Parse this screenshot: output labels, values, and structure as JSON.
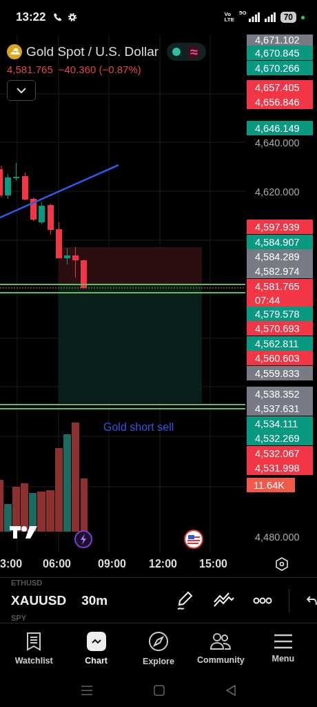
{
  "status_bar": {
    "time": "13:22",
    "volte_top": "Vo",
    "volte_bottom": "LTE",
    "network": "5G",
    "battery": "70"
  },
  "header": {
    "symbol_name": "Gold Spot / U.S. Dollar",
    "market_open_glyph": "≈",
    "price": "4,581.765",
    "change": "−40.360 (−0.87%)"
  },
  "chart": {
    "annotation": "Gold short sell",
    "price_scale": [
      {
        "text": "4,671.102",
        "kind": "tag",
        "color": "#787b86"
      },
      {
        "text": "4,670.845",
        "kind": "tag",
        "color": "#089981"
      },
      {
        "text": "4,670.266",
        "kind": "tag",
        "color": "#089981"
      },
      {
        "text": "4,657.405",
        "kind": "tag",
        "color": "#f23645"
      },
      {
        "text": "4,656.846",
        "kind": "tag",
        "color": "#f23645"
      },
      {
        "text": "4,646.149",
        "kind": "tag",
        "color": "#089981"
      },
      {
        "text": "4,640.000",
        "kind": "tick"
      },
      {
        "text": "4,620.000",
        "kind": "tick"
      },
      {
        "text": "4,597.939",
        "kind": "tag",
        "color": "#f23645"
      },
      {
        "text": "4,584.907",
        "kind": "tag",
        "color": "#089981"
      },
      {
        "text": "4,584.289",
        "kind": "tag",
        "color": "#787b86"
      },
      {
        "text": "4,582.974",
        "kind": "tag",
        "color": "#787b86"
      },
      {
        "text": "4,581.765",
        "kind": "tag",
        "color": "#f23645",
        "countdown": "07:44"
      },
      {
        "text": "4,579.578",
        "kind": "tag",
        "color": "#089981"
      },
      {
        "text": "4,570.693",
        "kind": "tag",
        "color": "#f23645"
      },
      {
        "text": "4,562.811",
        "kind": "tag",
        "color": "#089981"
      },
      {
        "text": "4,560.603",
        "kind": "tag",
        "color": "#f23645"
      },
      {
        "text": "4,559.833",
        "kind": "tag",
        "color": "#787b86"
      },
      {
        "text": "4,538.352",
        "kind": "tag",
        "color": "#787b86"
      },
      {
        "text": "4,537.631",
        "kind": "tag",
        "color": "#787b86"
      },
      {
        "text": "4,534.111",
        "kind": "tag",
        "color": "#089981"
      },
      {
        "text": "4,532.269",
        "kind": "tag",
        "color": "#089981"
      },
      {
        "text": "4,532.067",
        "kind": "tag",
        "color": "#f23645"
      },
      {
        "text": "4,531.998",
        "kind": "tag",
        "color": "#f23645"
      },
      {
        "text": "11.64K",
        "kind": "volume",
        "color": "#f05a4a"
      },
      {
        "text": "4,480.000",
        "kind": "tick"
      }
    ],
    "time_axis": [
      "3:00",
      "06:00",
      "09:00",
      "12:00",
      "15:00"
    ]
  },
  "toolbar": {
    "previous_symbol": "ETHUSD",
    "symbol": "XAUUSD",
    "interval": "30m",
    "next_symbol": "SPY"
  },
  "nav": [
    {
      "label": "Watchlist",
      "selected": false
    },
    {
      "label": "Chart",
      "selected": true
    },
    {
      "label": "Explore",
      "selected": false
    },
    {
      "label": "Community",
      "selected": false
    },
    {
      "label": "Menu",
      "selected": false
    }
  ]
}
